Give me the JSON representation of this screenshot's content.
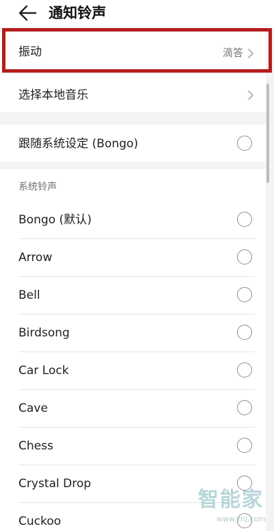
{
  "header": {
    "title": "通知铃声",
    "back_icon": "arrow-left-icon"
  },
  "top_card": {
    "vibration": {
      "label": "振动",
      "value": "滴答"
    },
    "local_music": {
      "label": "选择本地音乐"
    }
  },
  "follow_system": {
    "label": "跟随系统设定 (Bongo)",
    "selected": false
  },
  "system_ringtones": {
    "title": "系统铃声",
    "items": [
      {
        "label": "Bongo (默认)",
        "selected": false
      },
      {
        "label": "Arrow",
        "selected": false
      },
      {
        "label": "Bell",
        "selected": false
      },
      {
        "label": "Birdsong",
        "selected": false
      },
      {
        "label": "Car Lock",
        "selected": false
      },
      {
        "label": "Cave",
        "selected": false
      },
      {
        "label": "Chess",
        "selected": false
      },
      {
        "label": "Crystal Drop",
        "selected": false
      },
      {
        "label": "Cuckoo",
        "selected": false
      }
    ]
  },
  "watermark": {
    "text": "智能家",
    "url": "www.znj.com"
  },
  "colors": {
    "highlight_border": "#b51d1d",
    "background": "#f3f3f3",
    "radio_border": "#8c8c8c"
  }
}
